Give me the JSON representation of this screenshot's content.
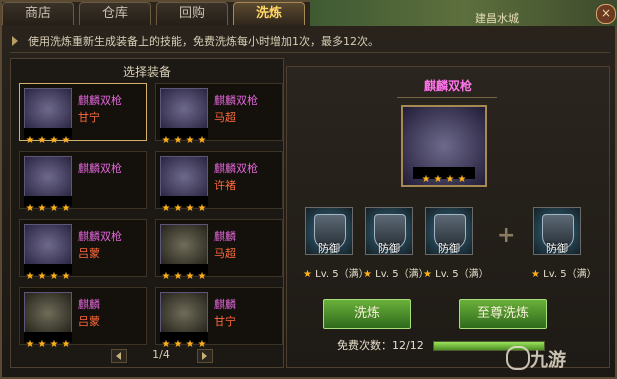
{
  "tabs": [
    "商店",
    "仓库",
    "回购",
    "洗炼"
  ],
  "active_tab_index": 3,
  "map_label": "建昌水城",
  "tip": "使用洗炼重新生成装备上的技能，免费洗炼每小时增加1次，最多12次。",
  "left": {
    "title": "选择装备",
    "items": [
      {
        "name": "麒麟双枪",
        "owner": "甘宁",
        "stars": 4,
        "selected": true,
        "type": "weapon"
      },
      {
        "name": "麒麟双枪",
        "owner": "马超",
        "stars": 4,
        "selected": false,
        "type": "weapon"
      },
      {
        "name": "麒麟双枪",
        "owner": "",
        "stars": 4,
        "selected": false,
        "type": "weapon"
      },
      {
        "name": "麒麟双枪",
        "owner": "许褚",
        "stars": 4,
        "selected": false,
        "type": "weapon"
      },
      {
        "name": "麒麟双枪",
        "owner": "吕蒙",
        "stars": 4,
        "selected": false,
        "type": "weapon"
      },
      {
        "name": "麒麟",
        "owner": "马超",
        "stars": 4,
        "selected": false,
        "type": "mount"
      },
      {
        "name": "麒麟",
        "owner": "吕蒙",
        "stars": 4,
        "selected": false,
        "type": "mount"
      },
      {
        "name": "麒麟",
        "owner": "甘宁",
        "stars": 4,
        "selected": false,
        "type": "mount"
      }
    ],
    "page": "1/4"
  },
  "right": {
    "title": "麒麟双枪",
    "big_stars": 4,
    "skills": [
      {
        "label": "防御",
        "lv": "Lv. 5（满）"
      },
      {
        "label": "防御",
        "lv": "Lv. 5（满）"
      },
      {
        "label": "防御",
        "lv": "Lv. 5（满）"
      },
      {
        "label": "防御",
        "lv": "Lv. 5（满）"
      }
    ],
    "plus_symbol": "+",
    "buttons": {
      "wash": "洗炼",
      "supreme_wash": "至尊洗炼"
    },
    "free_label": "免费次数：",
    "free_count": "12/12",
    "free_fraction": 1.0
  },
  "watermark": "九游",
  "colors": {
    "accent_gold": "#d4b06a",
    "item_name": "#e066d7",
    "owner": "#ff6a3a",
    "star": "#ffb21c",
    "button_green": "#6ab03a"
  }
}
